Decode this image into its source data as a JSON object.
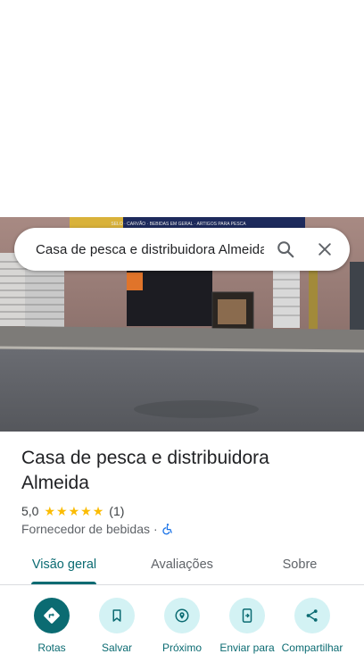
{
  "search": {
    "query": "Casa de pesca e distribuidora Almeida"
  },
  "photo": {
    "storefront_sign": "SELO · CARVÃO · BEBIDAS EM GERAL · ARTIGOS PARA PESCA"
  },
  "place": {
    "name": "Casa de pesca e distribuidora Almeida",
    "rating": "5,0",
    "review_count": "(1)",
    "stars": 5,
    "category": "Fornecedor de bebidas",
    "separator": "·"
  },
  "tabs": [
    {
      "label": "Visão geral",
      "active": true
    },
    {
      "label": "Avaliações",
      "active": false
    },
    {
      "label": "Sobre",
      "active": false
    }
  ],
  "actions": [
    {
      "label": "Rotas",
      "icon": "directions-icon"
    },
    {
      "label": "Salvar",
      "icon": "bookmark-icon"
    },
    {
      "label": "Próximo",
      "icon": "nearby-icon"
    },
    {
      "label": "Enviar para",
      "icon": "send-to-phone-icon"
    },
    {
      "label": "Compartilhar",
      "icon": "share-icon"
    }
  ],
  "colors": {
    "accent": "#0b6b72",
    "action_bg": "#d3f2f4",
    "star": "#fbbc04",
    "accessibility": "#1a73e8"
  }
}
